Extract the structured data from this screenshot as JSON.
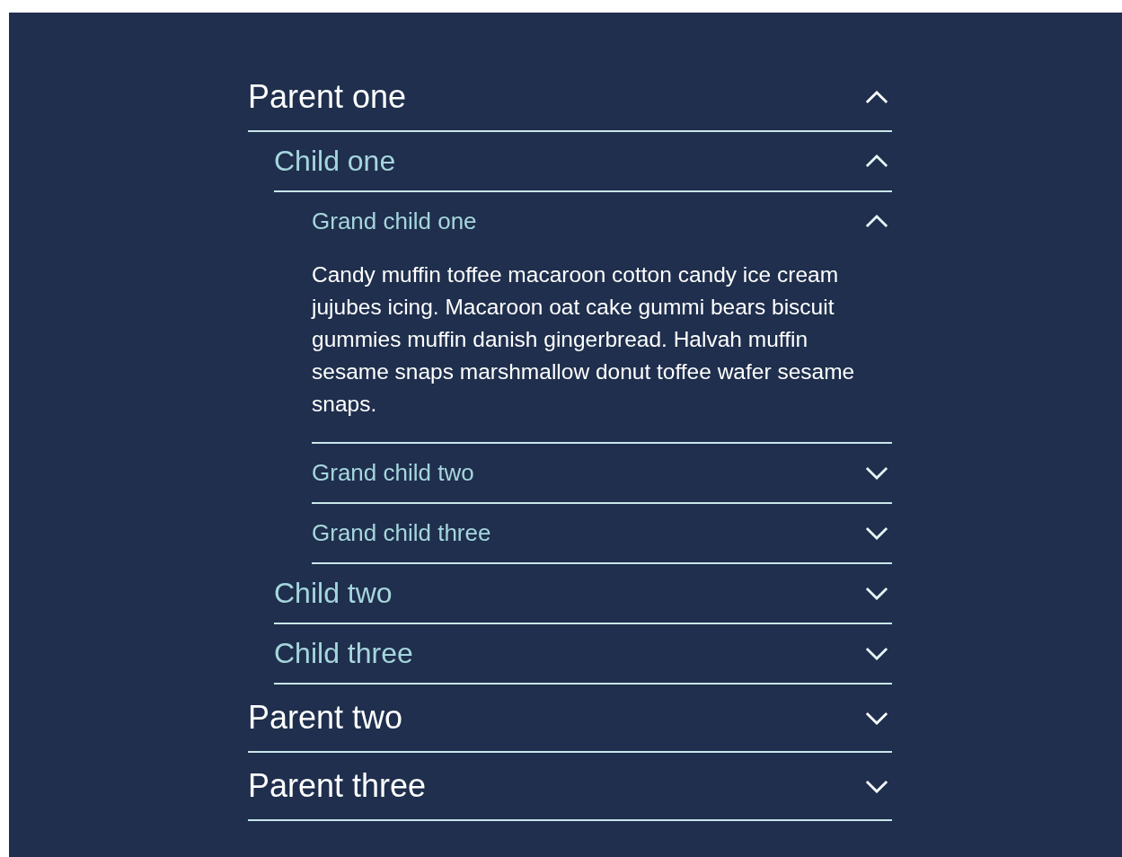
{
  "accordion": [
    {
      "title": "Parent one",
      "expanded": true,
      "children": [
        {
          "title": "Child one",
          "expanded": true,
          "children": [
            {
              "title": "Grand child one",
              "expanded": true,
              "text": "Candy muffin toffee macaroon cotton candy ice cream jujubes icing. Macaroon oat cake gummi bears biscuit gummies muffin danish gingerbread. Halvah muffin sesame snaps marshmallow donut toffee wafer sesame snaps."
            },
            {
              "title": "Grand child two",
              "expanded": false
            },
            {
              "title": "Grand child three",
              "expanded": false
            }
          ]
        },
        {
          "title": "Child two",
          "expanded": false
        },
        {
          "title": "Child three",
          "expanded": false
        }
      ]
    },
    {
      "title": "Parent two",
      "expanded": false
    },
    {
      "title": "Parent three",
      "expanded": false
    }
  ]
}
